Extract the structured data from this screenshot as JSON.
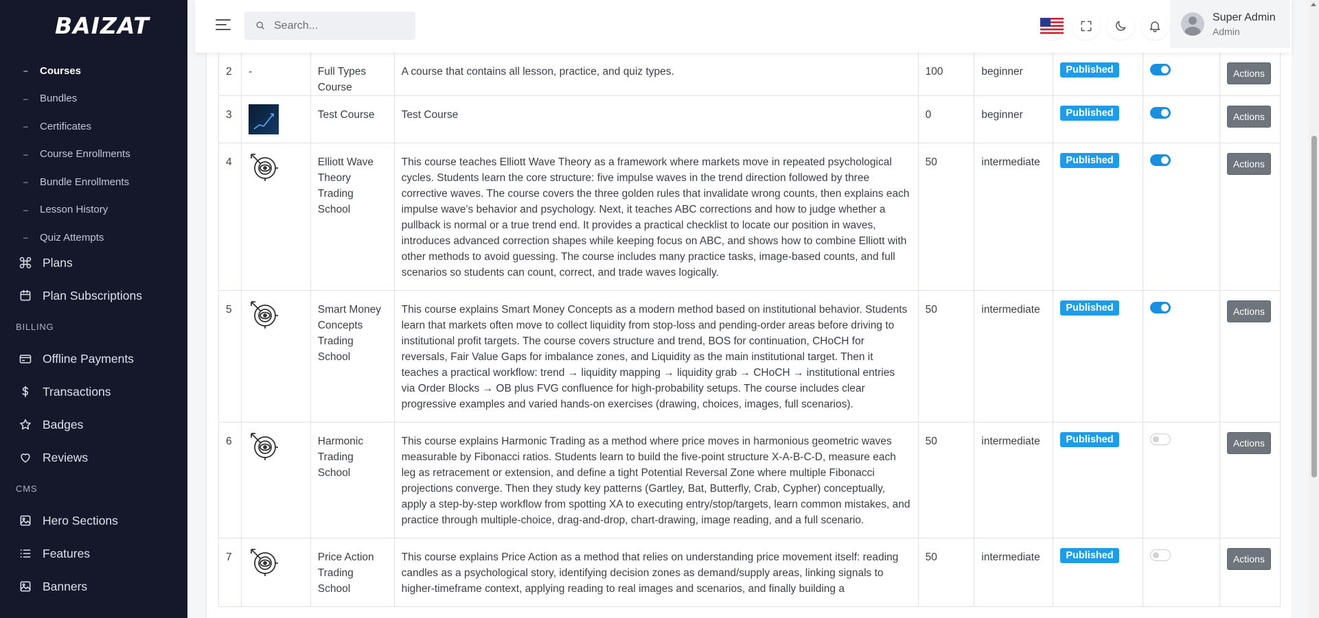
{
  "app": {
    "logo": "BAIZAT"
  },
  "sidebar": {
    "sub_items": [
      {
        "label": "Courses",
        "active": true
      },
      {
        "label": "Bundles"
      },
      {
        "label": "Certificates"
      },
      {
        "label": "Course Enrollments"
      },
      {
        "label": "Bundle Enrollments"
      },
      {
        "label": "Lesson History"
      },
      {
        "label": "Quiz Attempts"
      }
    ],
    "plans": "Plans",
    "plan_subscriptions": "Plan Subscriptions",
    "billing_label": "BILLING",
    "offline_payments": "Offline Payments",
    "transactions": "Transactions",
    "badges": "Badges",
    "reviews": "Reviews",
    "cms_label": "CMS",
    "hero_sections": "Hero Sections",
    "features": "Features",
    "banners": "Banners"
  },
  "header": {
    "search_placeholder": "Search...",
    "user_name": "Super Admin",
    "user_role": "Admin"
  },
  "table": {
    "rows": [
      {
        "num": "2",
        "thumb": "-",
        "title": "Full Types Course",
        "desc": "A course that contains all lesson, practice, and quiz types.",
        "price": "100",
        "level": "beginner",
        "status": "Published",
        "active": true,
        "action": "Actions"
      },
      {
        "num": "3",
        "thumb": "image",
        "title": "Test Course",
        "desc": "Test Course",
        "price": "0",
        "level": "beginner",
        "status": "Published",
        "active": true,
        "action": "Actions"
      },
      {
        "num": "4",
        "thumb": "target-icon",
        "title": "Elliott Wave Theory Trading School",
        "desc": "This course teaches Elliott Wave Theory as a framework where markets move in repeated psychological cycles. Students learn the core structure: five impulse waves in the trend direction followed by three corrective waves. The course covers the three golden rules that invalidate wrong counts, then explains each impulse wave's behavior and psychology. Next, it teaches ABC corrections and how to judge whether a pullback is normal or a true trend end. It provides a practical checklist to locate our position in waves, introduces advanced correction shapes while keeping focus on ABC, and shows how to combine Elliott with other methods to avoid guessing. The course includes many practice tasks, image-based counts, and full scenarios so students can count, correct, and trade waves logically.",
        "price": "50",
        "level": "intermediate",
        "status": "Published",
        "active": true,
        "action": "Actions"
      },
      {
        "num": "5",
        "thumb": "target-icon",
        "title": "Smart Money Concepts Trading School",
        "desc": "This course explains Smart Money Concepts as a modern method based on institutional behavior. Students learn that markets often move to collect liquidity from stop-loss and pending-order areas before driving to institutional profit targets. The course covers structure and trend, BOS for continuation, CHoCH for reversals, Fair Value Gaps for imbalance zones, and Liquidity as the main institutional target. Then it teaches a practical workflow: trend → liquidity mapping → liquidity grab → CHoCH → institutional entries via Order Blocks → OB plus FVG confluence for high-probability setups. The course includes clear progressive examples and varied hands-on exercises (drawing, choices, images, full scenarios).",
        "price": "50",
        "level": "intermediate",
        "status": "Published",
        "active": true,
        "action": "Actions"
      },
      {
        "num": "6",
        "thumb": "target-icon",
        "title": "Harmonic Trading School",
        "desc": "This course explains Harmonic Trading as a method where price moves in harmonious geometric waves measurable by Fibonacci ratios. Students learn to build the five-point structure X-A-B-C-D, measure each leg as retracement or extension, and define a tight Potential Reversal Zone where multiple Fibonacci projections converge. Then they study key patterns (Gartley, Bat, Butterfly, Crab, Cypher) conceptually, apply a step-by-step workflow from spotting XA to executing entry/stop/targets, learn common mistakes, and practice through multiple-choice, drag-and-drop, chart-drawing, image reading, and a full scenario.",
        "price": "50",
        "level": "intermediate",
        "status": "Published",
        "active": false,
        "action": "Actions"
      },
      {
        "num": "7",
        "thumb": "target-icon",
        "title": "Price Action Trading School",
        "desc": "This course explains Price Action as a method that relies on understanding price movement itself: reading candles as a psychological story, identifying decision zones as demand/supply areas, linking signals to higher-timeframe context, applying reading to real images and scenarios, and finally building a",
        "price": "50",
        "level": "intermediate",
        "status": "Published",
        "active": false,
        "action": "Actions"
      }
    ]
  },
  "colors": {
    "sidebar_bg": "#15172b",
    "badge": "#1e9be9",
    "toggle_on": "#1a8fe0",
    "actions_btn": "#6e757c"
  }
}
